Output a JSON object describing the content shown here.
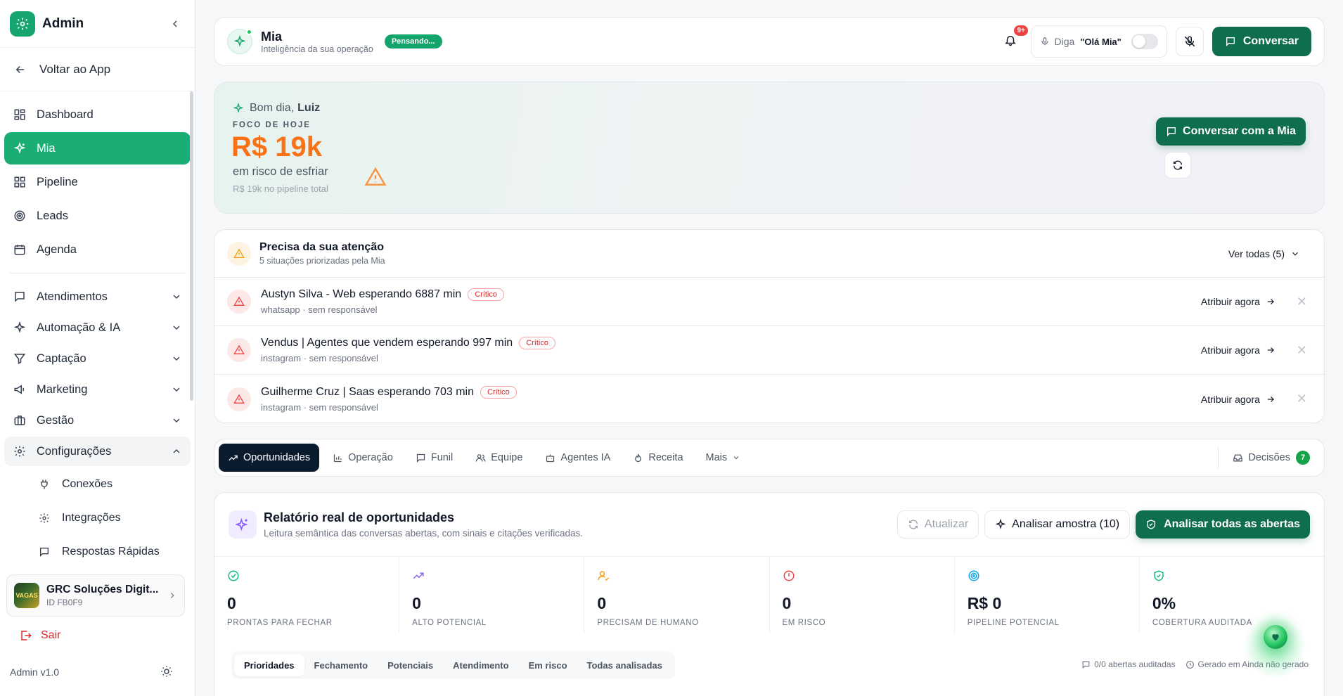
{
  "sidebar": {
    "title": "Admin",
    "back": "Voltar ao App",
    "items": [
      {
        "label": "Dashboard",
        "icon": "grid-icon"
      },
      {
        "label": "Mia",
        "icon": "sparkle-icon"
      },
      {
        "label": "Pipeline",
        "icon": "grid-icon"
      },
      {
        "label": "Leads",
        "icon": "target-icon"
      },
      {
        "label": "Agenda",
        "icon": "calendar-icon"
      }
    ],
    "groups": [
      {
        "label": "Atendimentos"
      },
      {
        "label": "Automação & IA"
      },
      {
        "label": "Captação"
      },
      {
        "label": "Marketing"
      },
      {
        "label": "Gestão"
      },
      {
        "label": "Configurações"
      }
    ],
    "sub_items": [
      {
        "label": "Conexões"
      },
      {
        "label": "Integrações"
      },
      {
        "label": "Respostas Rápidas"
      }
    ],
    "org": {
      "name": "GRC Soluções Digit...",
      "id": "ID FB0F9",
      "avatar_text": "VAGAS"
    },
    "logout": "Sair",
    "version": "Admin v1.0"
  },
  "topbar": {
    "name": "Mia",
    "subtitle": "Inteligência da sua operação",
    "status": "Pensando...",
    "notif_count": "9+",
    "say_label": "Diga",
    "say_phrase": "\"Olá Mia\"",
    "chat_button": "Conversar"
  },
  "hero": {
    "greeting": "Bom dia,",
    "user": "Luiz",
    "focus_label": "FOCO DE HOJE",
    "amount": "R$ 19k",
    "risk_text": "em risco de esfriar",
    "pipeline_text": "R$ 19k no pipeline total",
    "chat_button": "Conversar com a Mia"
  },
  "attention": {
    "title": "Precisa da sua atenção",
    "subtitle": "5 situações priorizadas pela Mia",
    "see_all": "Ver todas (5)",
    "rows": [
      {
        "title": "Austyn Silva - Web esperando 6887 min",
        "badge": "Crítico",
        "sub": "whatsapp · sem responsável",
        "action": "Atribuir agora"
      },
      {
        "title": "Vendus | Agentes que vendem esperando 997 min",
        "badge": "Crítico",
        "sub": "instagram · sem responsável",
        "action": "Atribuir agora"
      },
      {
        "title": "Guilherme Cruz | Saas esperando 703 min",
        "badge": "Crítico",
        "sub": "instagram · sem responsável",
        "action": "Atribuir agora"
      }
    ]
  },
  "tabs": {
    "items": [
      "Oportunidades",
      "Operação",
      "Funil",
      "Equipe",
      "Agentes IA",
      "Receita",
      "Mais"
    ],
    "decisions": "Decisões",
    "decisions_count": "7"
  },
  "report": {
    "title": "Relatório real de oportunidades",
    "subtitle": "Leitura semântica das conversas abertas, com sinais e citações verificadas.",
    "refresh": "Atualizar",
    "sample": "Analisar amostra (10)",
    "all": "Analisar todas as abertas",
    "stats": [
      {
        "value": "0",
        "label": "PRONTAS PARA FECHAR",
        "color": "#10b981"
      },
      {
        "value": "0",
        "label": "ALTO POTENCIAL",
        "color": "#8b5cf6"
      },
      {
        "value": "0",
        "label": "PRECISAM DE HUMANO",
        "color": "#f59e0b"
      },
      {
        "value": "0",
        "label": "EM RISCO",
        "color": "#ef4444"
      },
      {
        "value": "R$ 0",
        "label": "PIPELINE POTENCIAL",
        "color": "#0ea5e9"
      },
      {
        "value": "0%",
        "label": "COBERTURA AUDITADA",
        "color": "#10b981"
      }
    ],
    "subtabs": [
      "Prioridades",
      "Fechamento",
      "Potenciais",
      "Atendimento",
      "Em risco",
      "Todas analisadas"
    ],
    "audited": "0/0 abertas auditadas",
    "generated": "Gerado em Ainda não gerado"
  }
}
